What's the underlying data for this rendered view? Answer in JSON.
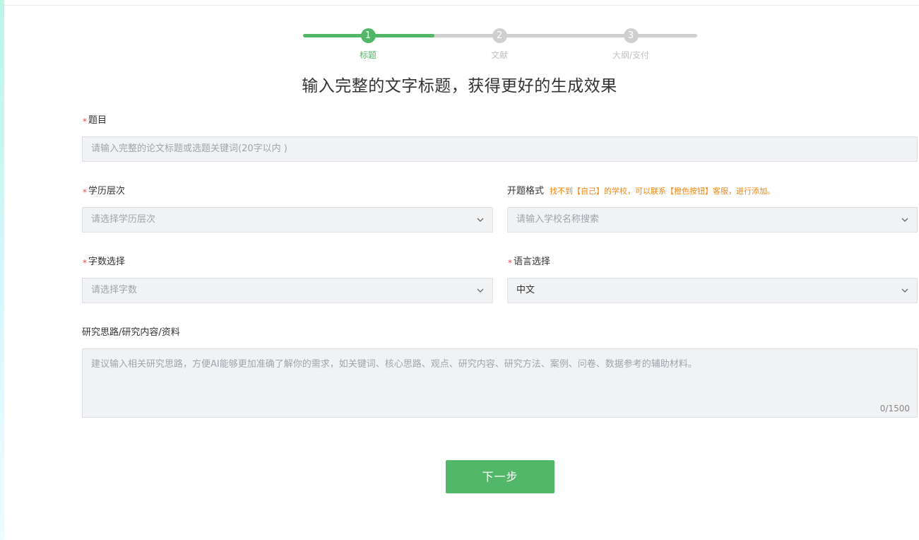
{
  "steps": [
    {
      "number": "1",
      "label": "标题",
      "status": "active"
    },
    {
      "number": "2",
      "label": "文献",
      "status": "todo"
    },
    {
      "number": "3",
      "label": "大纲/支付",
      "status": "todo"
    }
  ],
  "progress_fraction": 0.333,
  "headline": "输入完整的文字标题，获得更好的生成效果",
  "form": {
    "title": {
      "label": "题目",
      "required_mark": "*",
      "placeholder": "请输入完整的论文标题或选题关键词(20字以内 )",
      "value": ""
    },
    "education": {
      "label": "学历层次",
      "required_mark": "*",
      "placeholder": "请选择学历层次",
      "value": ""
    },
    "format": {
      "label": "开题格式",
      "hint": "找不到【自己】的学校，可以联系【橙色按钮】客服，进行添加。",
      "placeholder": "请输入学校名称搜索",
      "value": ""
    },
    "word_count": {
      "label": "字数选择",
      "required_mark": "*",
      "placeholder": "请选择字数",
      "value": ""
    },
    "language": {
      "label": "语言选择",
      "required_mark": "*",
      "value": "中文"
    },
    "research": {
      "label": "研究思路/研究内容/资料",
      "placeholder": "建议输入相关研究思路，方便AI能够更加准确了解你的需求，如关键词、核心思路、观点、研究内容、研究方法、案例、问卷、数据参考的辅助材料。",
      "counter": "0/1500"
    }
  },
  "next_button": "下一步",
  "colors": {
    "accent": "#52b768",
    "required": "#f04848",
    "hint": "#f2860f",
    "field_bg": "#f1f2f4",
    "inactive_step": "#cfcfcf"
  },
  "icons": {
    "dropdown": "chevron-down-icon"
  }
}
